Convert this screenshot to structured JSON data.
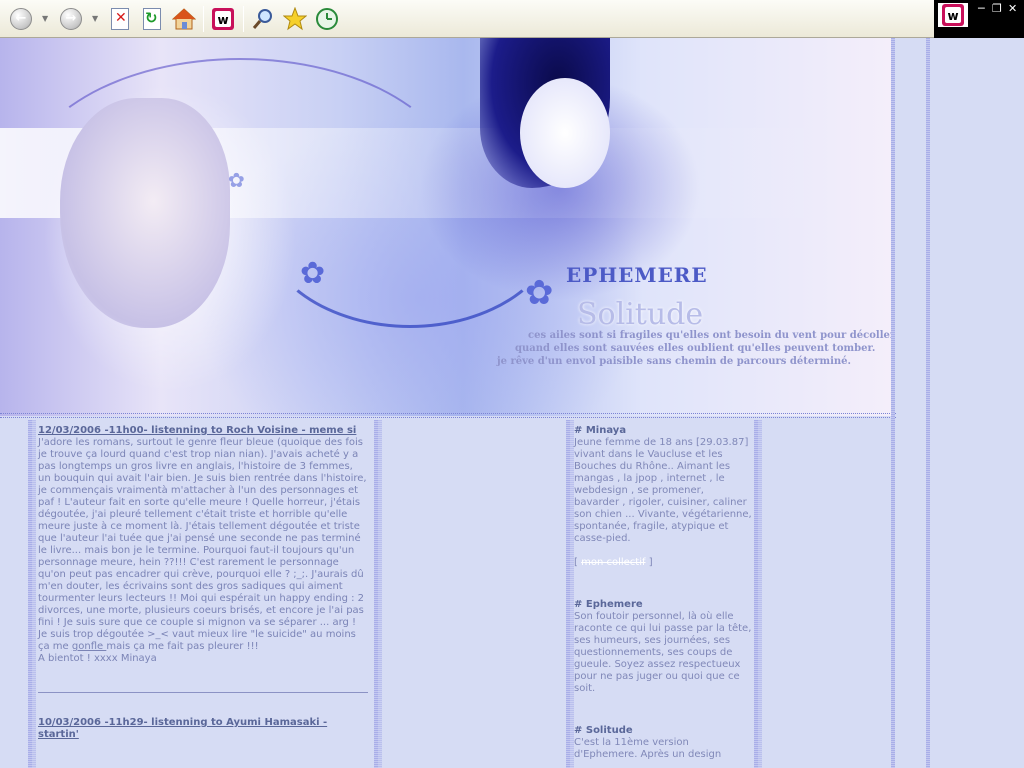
{
  "toolbar": {
    "buttons": [
      {
        "name": "back-button",
        "icon": "arrow-left-icon"
      },
      {
        "name": "forward-button",
        "icon": "arrow-right-icon"
      },
      {
        "name": "stop-button",
        "icon": "stop-x-icon"
      },
      {
        "name": "refresh-button",
        "icon": "refresh-icon"
      },
      {
        "name": "home-button",
        "icon": "home-icon"
      },
      {
        "name": "w-app-button",
        "icon": "w-logo-icon"
      },
      {
        "name": "search-button",
        "icon": "magnifier-icon"
      },
      {
        "name": "favorites-button",
        "icon": "star-icon"
      },
      {
        "name": "history-button",
        "icon": "history-icon"
      }
    ]
  },
  "banner": {
    "title": "EPHEMERE",
    "subtitle": "Solitude",
    "lines": [
      "ces ailes sont si fragiles qu'elles ont besoin du vent pour décoller.",
      "quand elles sont sauvées elles oublient qu'elles peuvent tomber.",
      "je rêve d'un envol paisible sans chemin de parcours déterminé."
    ]
  },
  "posts": [
    {
      "title": "12/03/2006 -11h00- listenning to Roch Voisine - meme si",
      "body_before_link": "J'adore les romans, surtout le genre fleur bleue (quoique des fois je trouve ça lourd quand c'est trop nian nian). J'avais acheté y a pas longtemps un gros livre en anglais, l'histoire de 3 femmes, un bouquin qui avait l'air bien. Je suis bien rentrée dans l'histoire, je commençais vraimentà m'attacher à l'un des personnages et paf ! L'auteur fait en sorte qu'elle meure ! Quelle horreur, j'étais dégoutée, j'ai pleuré tellement c'était triste et horrible qu'elle meure juste à ce moment là. J'étais tellement dégoutée et triste que l'auteur l'ai tuée que j'ai pensé une seconde ne pas terminé le livre... mais bon je le termine. Pourquoi faut-il toujours qu'un personnage meure, hein ??!!! C'est rarement le personnage qu'on peut pas encadrer qui crève, pourquoi elle ? ;_;. J'aurais dû m'en douter, les écrivains sont des gros sadiques qui aiment tourmenter leurs lecteurs !! Moi qui espérait un happy ending : 2 divorces, une morte, plusieurs coeurs brisés, et encore je l'ai pas fini ! Je suis sure que ce couple si mignon va se séparer ... arg ! Je suis trop dégoutée >_< vaut mieux lire \"le suicide\" au moins ça me",
      "link": "gonfle ",
      "body_after_link": "mais ça me fait pas pleurer !!!",
      "signature": "A bientot ! xxxx Minaya"
    },
    {
      "title": "10/03/2006 -11h29- listenning to Ayumi Hamasaki - startin'"
    }
  ],
  "sidebar": {
    "minaya": {
      "heading": "# Minaya",
      "text": "Jeune femme de 18 ans [29.03.87] vivant dans le Vaucluse et les Bouches du Rhône.. Aimant les mangas , la jpop , internet , le webdesign , se promener, bavarder , rigoler, cuisiner, caliner son chien ... Vivante, végétarienne, spontanée, fragile, atypique et casse-pied."
    },
    "collectif": {
      "open": "[ ",
      "label": "mon collectif",
      "close": " ]"
    },
    "ephemere": {
      "heading": "# Ephemere",
      "text": "Son foutoir personnel, là où elle raconte ce qui lui passe par la tête, ses humeurs, ses journées, ses questionnements, ses coups de gueule. Soyez assez respectueux pour ne pas juger ou quoi que ce soit."
    },
    "solitude": {
      "heading": "# Solitude",
      "text": "C'est la 11ème version d'Ephemere. Après un design"
    }
  },
  "colors": {
    "background": "#d6dcf4",
    "text": "#7b84b6",
    "heading": "#5a6799",
    "stripe": "#a8aee8"
  }
}
